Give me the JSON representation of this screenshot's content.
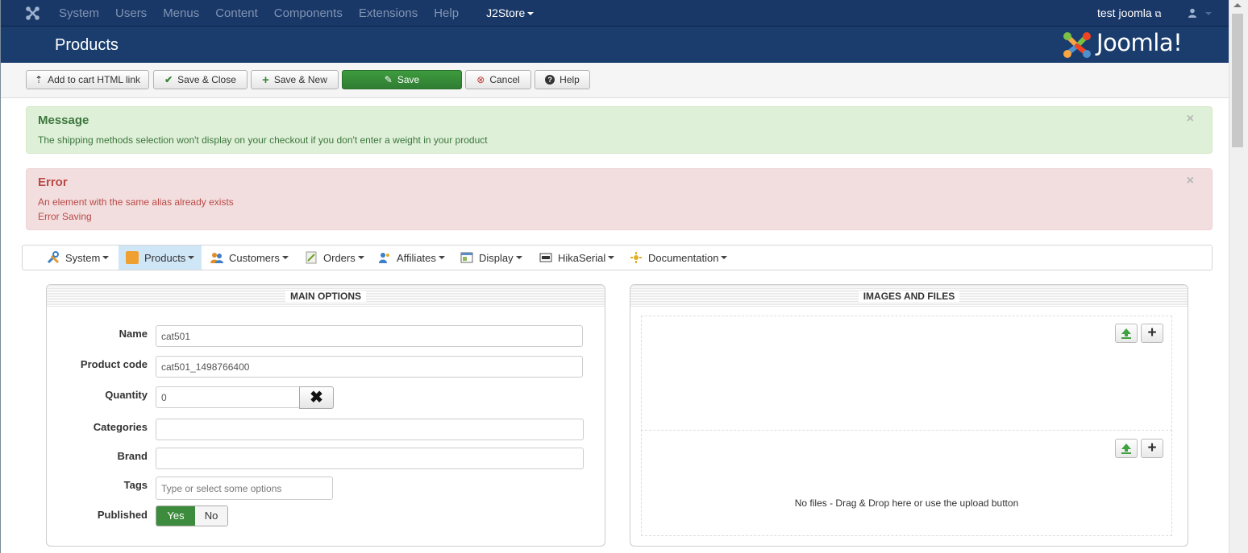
{
  "topnav": {
    "menu": [
      "System",
      "Users",
      "Menus",
      "Content",
      "Components",
      "Extensions",
      "Help"
    ],
    "j2store": "J2Store",
    "user_link": "test joomla",
    "icons": [
      "joomla-icon",
      "user-icon"
    ]
  },
  "header": {
    "title": "Products",
    "brand": "Joomla!"
  },
  "toolbar": {
    "add_cart": "Add to cart HTML link",
    "save_close": "Save & Close",
    "save_new": "Save & New",
    "save": "Save",
    "cancel": "Cancel",
    "help": "Help"
  },
  "alerts": {
    "message": {
      "heading": "Message",
      "text": "The shipping methods selection won't display on your checkout if you don't enter a weight in your product"
    },
    "error": {
      "heading": "Error",
      "line1": "An element with the same alias already exists",
      "line2": "Error Saving"
    },
    "close": "×"
  },
  "component_menu": [
    {
      "label": "System"
    },
    {
      "label": "Products"
    },
    {
      "label": "Customers"
    },
    {
      "label": "Orders"
    },
    {
      "label": "Affiliates"
    },
    {
      "label": "Display"
    },
    {
      "label": "HikaSerial"
    },
    {
      "label": "Documentation"
    }
  ],
  "main_options": {
    "heading": "MAIN OPTIONS",
    "name_label": "Name",
    "name_value": "cat501",
    "code_label": "Product code",
    "code_value": "cat501_1498766400",
    "quantity_label": "Quantity",
    "quantity_value": "0",
    "quantity_clear": "✖",
    "categories_label": "Categories",
    "brand_label": "Brand",
    "tags_label": "Tags",
    "tags_placeholder": "Type or select some options",
    "published_label": "Published",
    "published_yes": "Yes",
    "published_no": "No"
  },
  "images_files": {
    "heading": "IMAGES AND FILES",
    "no_files": "No files - Drag & Drop here or use the upload button"
  },
  "colors": {
    "nav_bg": "#1a3867",
    "header_bg": "#1a3d6e",
    "save_green": "#3e9b3e",
    "message_bg": "#dff0d8",
    "error_bg": "#f2dede",
    "active_menu": "#cfe6f7"
  }
}
